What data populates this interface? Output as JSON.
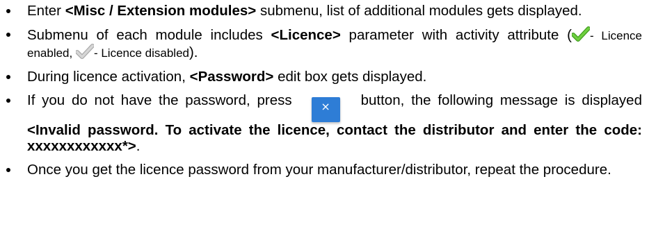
{
  "bullets": [
    {
      "parts": [
        {
          "text": "Enter ",
          "bold": false
        },
        {
          "text": "<Misc / Extension modules>",
          "bold": true
        },
        {
          "text": " submenu, list of additional modules gets displayed.",
          "bold": false
        }
      ]
    },
    {
      "parts": [
        {
          "text": "Submenu of each module includes ",
          "bold": false
        },
        {
          "text": "<Licence>",
          "bold": true
        },
        {
          "text": " parameter with activity attribute (",
          "bold": false
        }
      ],
      "enabled_icon": "check-green-icon",
      "enabled_text": "- Licence enabled, ",
      "disabled_icon": "check-grey-icon",
      "disabled_text": "- Licence disabled",
      "closing": ")."
    },
    {
      "parts": [
        {
          "text": "During licence activation, ",
          "bold": false
        },
        {
          "text": "<Password>",
          "bold": true
        },
        {
          "text": " edit box gets displayed.",
          "bold": false
        }
      ]
    },
    {
      "before_button": "If you do not have the password, press",
      "button_icon": "close-x-icon",
      "button_glyph": "×",
      "after_button": "button, the following message is displayed ",
      "message": "<Invalid password. To activate the licence, contact the distributor and enter the code: xxxxxxxxxxxx*>",
      "end": "."
    },
    {
      "parts": [
        {
          "text": "Once you get the licence password from your manufacturer/distributor, repeat the procedure.",
          "bold": false
        }
      ]
    }
  ],
  "colors": {
    "check_enabled": "#5cc232",
    "check_disabled": "#c4c4c4",
    "button_bg": "#2e7dd6"
  }
}
